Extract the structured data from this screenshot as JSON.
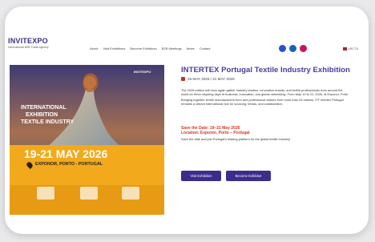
{
  "logo": {
    "name": "INVITEXPO",
    "tagline": "International B2B Trade Agency"
  },
  "nav": {
    "items": [
      "About",
      "Visit Exhibitions",
      "Become Exhibitors",
      "B2B Meetings",
      "News",
      "Contact"
    ],
    "language": "US-TX"
  },
  "hero": {
    "badge": "INVITEXPO",
    "line1": "INTERNATIONAL",
    "line2": "EXHIBITION",
    "line3": "TEXTILE INDUSTRY",
    "dates": "19-21 MAY 2026",
    "venue": "EXPONOR, PORTO - PORTUGAL"
  },
  "event": {
    "title": "INTERTEX Portugal Textile Industry Exhibition",
    "date": "19 MAY 2026 / 21 MAY 2026",
    "para1": "The 2026 edition will once again gather industry leaders, innovation brands, and textile professionals from around the world for three inspiring days of business, innovation, and global networking. From May 19 to 21, 2026, at Exponor, Porto",
    "para2": "Bringing together textile manufacturers from and professional visitors from more than 25 nations, ITF Intertex Portugal remains a vibrant international hub for sourcing, trends, and collaboration.",
    "save_date": "Save the Date: 19–21 May 2026",
    "location": "Location: Exponor, Porto – Portugal",
    "note": "Save the date and join Portugal's leading platform for the global textile industry!"
  },
  "buttons": {
    "visit": "Visit Exhibition",
    "become": "Become Exhibitor"
  },
  "colors": {
    "brand": "#3c2c8c",
    "accent": "#d8361e",
    "hero_yellow": "#f2a91b"
  }
}
